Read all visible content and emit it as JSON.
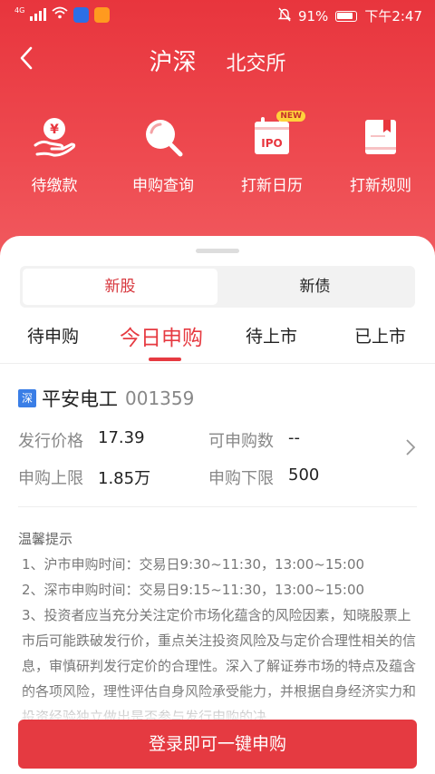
{
  "status_bar": {
    "network": "4G",
    "battery": "91%",
    "time": "下午2:47"
  },
  "nav": {
    "tabs": [
      {
        "label": "沪深",
        "active": true
      },
      {
        "label": "北交所",
        "active": false
      }
    ]
  },
  "quick_actions": [
    {
      "label": "待缴款",
      "icon": "money-hand-icon"
    },
    {
      "label": "申购查询",
      "icon": "search-icon"
    },
    {
      "label": "打新日历",
      "icon": "ipo-calendar-icon",
      "badge": "NEW"
    },
    {
      "label": "打新规则",
      "icon": "rules-book-icon"
    }
  ],
  "segment": {
    "options": [
      "新股",
      "新债"
    ],
    "selected": "新股"
  },
  "tabs": [
    {
      "label": "待申购"
    },
    {
      "label": "今日申购",
      "active": true
    },
    {
      "label": "待上市"
    },
    {
      "label": "已上市"
    }
  ],
  "stock": {
    "market_badge": "深",
    "name": "平安电工",
    "code": "001359",
    "fields": {
      "issue_price_label": "发行价格",
      "issue_price": "17.39",
      "subscribable_label": "可申购数",
      "subscribable": "--",
      "upper_limit_label": "申购上限",
      "upper_limit": "1.85万",
      "lower_limit_label": "申购下限",
      "lower_limit": "500"
    }
  },
  "notice": {
    "title": "温馨提示",
    "lines": [
      "1、沪市申购时间：交易日9:30~11:30，13:00~15:00",
      "2、深市申购时间：交易日9:15~11:30，13:00~15:00",
      "3、投资者应当充分关注定价市场化蕴含的风险因素，知晓股票上市后可能跌破发行价，重点关注投资风险及与定价合理性相关的信息，审慎研判发行定价的合理性。深入了解证券市场的特点及蕴含的各项风险，理性评估自身风险承受能力，并根据自身经济实力和投资经验独立做出是否参与发行申购的决"
    ]
  },
  "cta": {
    "label": "登录即可一键申购"
  },
  "colors": {
    "brand_red": "#e53a41",
    "market_badge_blue": "#3a7ee6"
  }
}
